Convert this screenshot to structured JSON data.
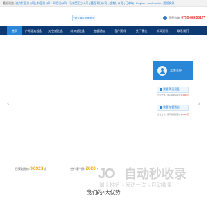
{
  "topbar": {
    "label": "最近浏览:",
    "links": "澳大利亚分公司 | 韩国分公司 | 印尼分公司 | 马来西亚分公司 | 墨西哥分公司 | 越南分公司 | 日本站 | English | mmh-sa-kk | 图纸实录"
  },
  "header": {
    "brand_box": "一站式酒店设备服务商",
    "hotline_label": "免费咨询:",
    "hotline_number": "0755-88655177"
  },
  "nav": {
    "items": [
      "首页",
      "户外酒店设备",
      "太空舱设备",
      "未来舱设备",
      "加盟酒店",
      "客户案例",
      "关于鼎佳",
      "新闻资讯",
      "联系我们"
    ]
  },
  "side_panel": {
    "head_label": "立即注册",
    "button_1": "我要 购买设备",
    "note_1": "*企业合作，即可免费获取价值",
    "note_1_amount": "2800元",
    "button_2": "我要 加盟酒店",
    "note_2": "*企业合作，即可免费获取价值",
    "note_2_amount": "2800元"
  },
  "stats": {
    "label_1": "已获取报价",
    "value_1": "96928",
    "unit_1": "次",
    "label_2": "合作客户数",
    "value_2": "2000",
    "unit_2": "+"
  },
  "watermark": {
    "logo": "JO",
    "title": "自动秒收录",
    "subtitle": "做上排名→来访一次→自动收录"
  },
  "section": {
    "title": "我们的4大优势"
  },
  "colors": {
    "nav_bg": "#0e3a73",
    "nav_active": "#2a87d8",
    "accent_red": "#e0392d",
    "stat_orange": "#f3a60c"
  }
}
